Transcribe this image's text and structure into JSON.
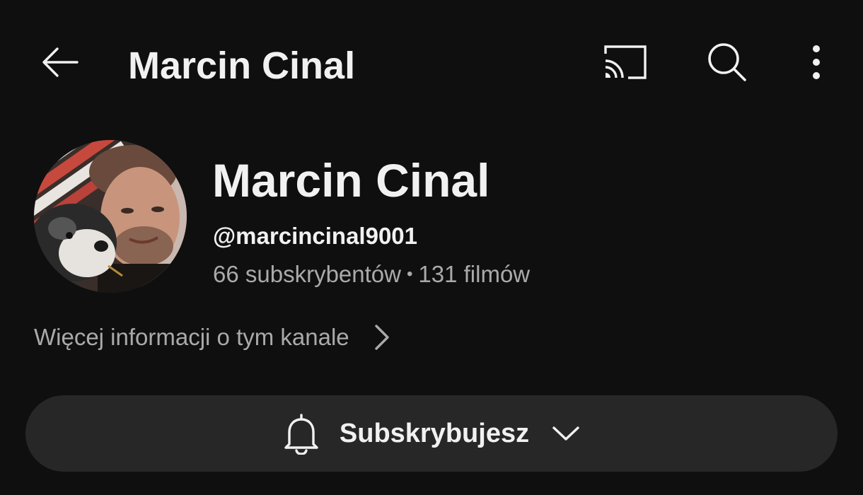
{
  "header": {
    "title": "Marcin Cinal",
    "icons": {
      "back": "arrow-left-icon",
      "cast": "cast-icon",
      "search": "search-icon",
      "more": "more-vertical-icon"
    }
  },
  "channel": {
    "name": "Marcin Cinal",
    "handle": "@marcincinal9001",
    "subscribers": "66 subskrybentów",
    "separator": "•",
    "videos": "131 filmów",
    "more_info_label": "Więcej informacji o tym kanale"
  },
  "subscribe": {
    "label": "Subskrybujesz",
    "icon": "bell-icon",
    "dropdown_icon": "chevron-down-icon"
  },
  "colors": {
    "background": "#0f0f0f",
    "text_primary": "#f1f1f1",
    "text_secondary": "#aaaaaa",
    "button_background": "#272727"
  }
}
